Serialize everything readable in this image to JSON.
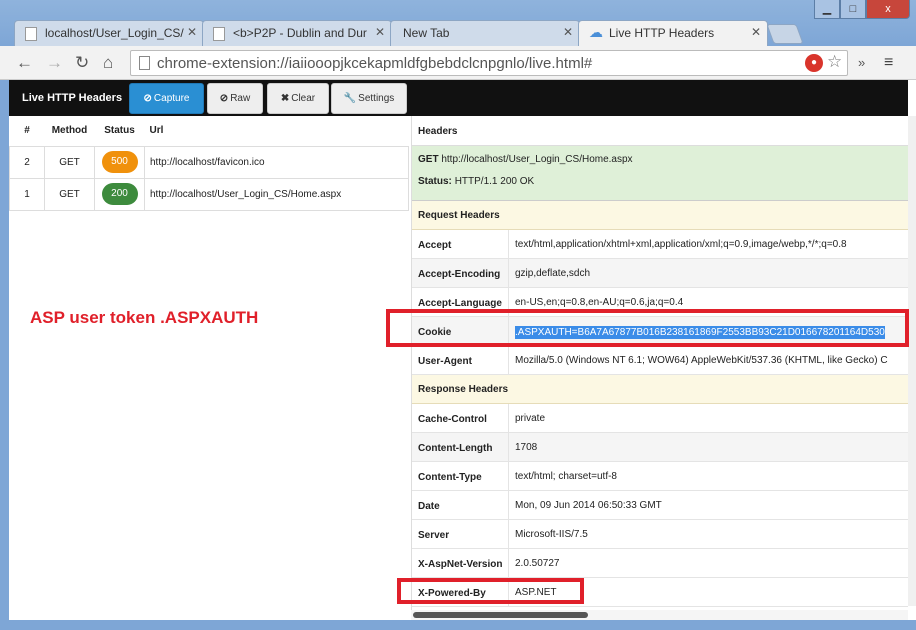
{
  "browser": {
    "tabs": [
      {
        "label": "localhost/User_Login_CS/"
      },
      {
        "label": "<b>P2P - Dublin and Dur"
      },
      {
        "label": "New Tab"
      },
      {
        "label": "Live HTTP Headers"
      }
    ],
    "address": "chrome-extension://iaiiooopjkcekapmldfgbebdclcnpgnlo/live.html#",
    "window_close": "x"
  },
  "app": {
    "brand": "Live HTTP Headers",
    "capture": "Capture",
    "raw": "Raw",
    "clear": "Clear",
    "settings": "Settings"
  },
  "requests": {
    "headers": [
      "#",
      "Method",
      "Status",
      "Url"
    ],
    "rows": [
      {
        "num": "2",
        "method": "GET",
        "status": "500",
        "status_color": "#f0910c",
        "url": "http://localhost/favicon.ico"
      },
      {
        "num": "1",
        "method": "GET",
        "status": "200",
        "status_color": "#3d8b3d",
        "url": "http://localhost/User_Login_CS/Home.aspx"
      }
    ]
  },
  "annotation": "ASP user token .ASPXAUTH",
  "detail": {
    "title": "Headers",
    "method": "GET",
    "url": "http://localhost/User_Login_CS/Home.aspx",
    "status_label": "Status:",
    "status_value": "HTTP/1.1 200 OK",
    "request_section": "Request Headers",
    "request_headers": [
      {
        "name": "Accept",
        "value": "text/html,application/xhtml+xml,application/xml;q=0.9,image/webp,*/*;q=0.8"
      },
      {
        "name": "Accept-Encoding",
        "value": "gzip,deflate,sdch"
      },
      {
        "name": "Accept-Language",
        "value": "en-US,en;q=0.8,en-AU;q=0.6,ja;q=0.4"
      },
      {
        "name": "Cookie",
        "value": ".ASPXAUTH=B6A7A67877B016B238161869F2553BB93C21D016678201164D530"
      },
      {
        "name": "User-Agent",
        "value": "Mozilla/5.0 (Windows NT 6.1; WOW64) AppleWebKit/537.36 (KHTML, like Gecko) C"
      }
    ],
    "response_section": "Response Headers",
    "response_headers": [
      {
        "name": "Cache-Control",
        "value": "private"
      },
      {
        "name": "Content-Length",
        "value": "1708"
      },
      {
        "name": "Content-Type",
        "value": "text/html; charset=utf-8"
      },
      {
        "name": "Date",
        "value": "Mon, 09 Jun 2014 06:50:33 GMT"
      },
      {
        "name": "Server",
        "value": "Microsoft-IIS/7.5"
      },
      {
        "name": "X-AspNet-Version",
        "value": "2.0.50727"
      },
      {
        "name": "X-Powered-By",
        "value": "ASP.NET"
      }
    ]
  }
}
